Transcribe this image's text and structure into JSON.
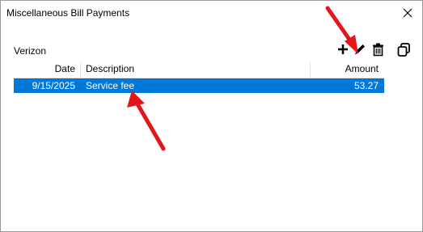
{
  "window": {
    "title": "Miscellaneous Bill Payments",
    "close_label": "Close"
  },
  "account": {
    "name": "Verizon"
  },
  "toolbar": {
    "add_icon": "plus-icon",
    "edit_icon": "pencil-icon",
    "delete_icon": "trash-icon",
    "copy_icon": "copy-icon"
  },
  "table": {
    "columns": [
      "Date",
      "Description",
      "Amount"
    ],
    "rows": [
      {
        "date": "9/15/2025",
        "description": "Service fee",
        "amount": "53.27",
        "selected": true
      }
    ]
  },
  "colors": {
    "selection": "#0078d7",
    "annotation_arrow": "#e3161b"
  }
}
